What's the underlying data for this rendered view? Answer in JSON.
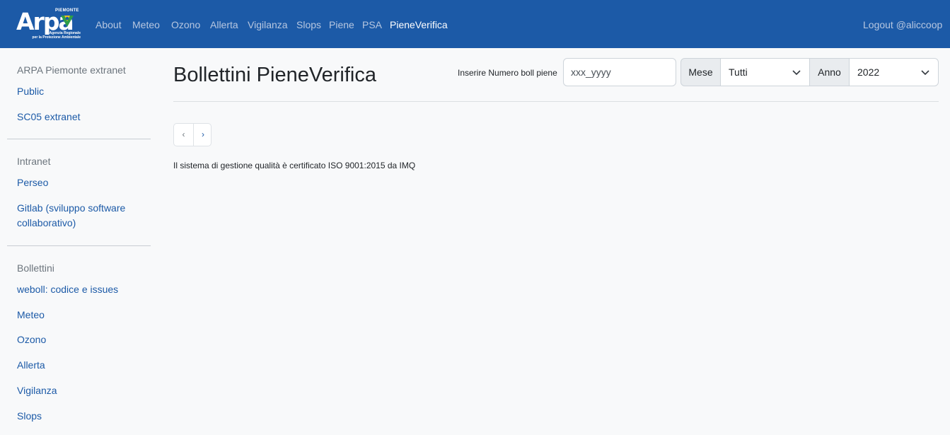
{
  "brand": {
    "logo_text": "Arpa",
    "logo_region": "PIEMONTE",
    "logo_sub_line1": "Agenzia Regionale",
    "logo_sub_line2": "per la Protezione Ambientale"
  },
  "nav": {
    "items": [
      {
        "label": "About"
      },
      {
        "label": "Meteo"
      },
      {
        "label": "Ozono"
      },
      {
        "label": "Allerta"
      },
      {
        "label": "Vigilanza"
      },
      {
        "label": "Slops"
      },
      {
        "label": "Piene"
      },
      {
        "label": "PSA"
      },
      {
        "label": "PieneVerifica",
        "active": true
      }
    ],
    "logout": "Logout @aliccoop"
  },
  "sidebar": {
    "sections": [
      {
        "heading": "ARPA Piemonte extranet",
        "links": [
          "Public",
          "SC05 extranet"
        ]
      },
      {
        "heading": "Intranet",
        "links": [
          "Perseo",
          "Gitlab (sviluppo software",
          "collaborativo)"
        ]
      },
      {
        "heading": "Bollettini",
        "links": [
          "weboll: codice e issues",
          "Meteo",
          "Ozono",
          "Allerta",
          "Vigilanza",
          "Slops"
        ]
      }
    ]
  },
  "main": {
    "title": "Bollettini PieneVerifica",
    "search_label": "Inserire Numero boll piene",
    "search_placeholder": "xxx_yyyy",
    "month_label": "Mese",
    "month_value": "Tutti",
    "year_label": "Anno",
    "year_value": "2022",
    "pager_prev": "‹",
    "pager_next": "›",
    "footer": "Il sistema di gestione qualità è certificato ISO 9001:2015 da IMQ"
  },
  "colors": {
    "navbar": "#1c5aa7",
    "link": "#1c5aa7",
    "page_bg": "#f8f9fa"
  }
}
